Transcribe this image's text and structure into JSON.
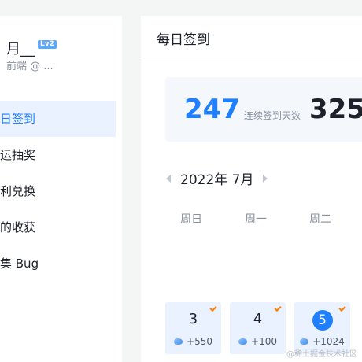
{
  "sidebar": {
    "user_name": "月__",
    "user_level": "Lv2",
    "user_subtitle": "前端 @ ...",
    "items": [
      {
        "label": "日签到"
      },
      {
        "label": "运抽奖"
      },
      {
        "label": "利兑换"
      },
      {
        "label": "的收获"
      },
      {
        "label": "集 Bug"
      }
    ]
  },
  "main": {
    "title": "每日签到",
    "stats": {
      "streak_value": "247",
      "streak_label": "连续签到天数",
      "total_value": "325"
    },
    "month_label": "2022年 7月",
    "weekdays": [
      "周日",
      "周一",
      "周二"
    ],
    "days": [
      {
        "day": "3",
        "reward": "+550",
        "checked": true
      },
      {
        "day": "4",
        "reward": "+100",
        "checked": true
      },
      {
        "day": "5",
        "reward": "+1024",
        "checked": true,
        "today": true
      }
    ]
  },
  "watermark": "@稀土掘金技术社区",
  "colors": {
    "accent": "#1e80ff",
    "active_bg": "#eaf2ff",
    "check": "#ff7d00"
  }
}
